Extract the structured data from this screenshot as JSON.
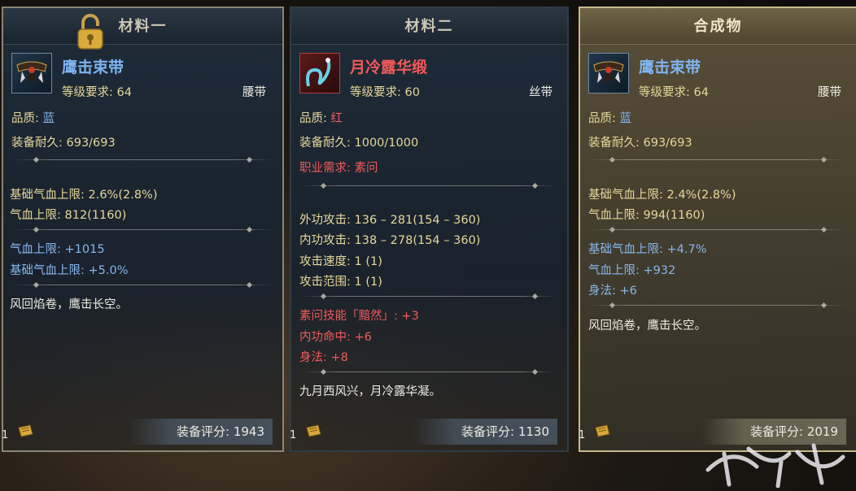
{
  "panels": [
    {
      "header": "材料一",
      "item_name": "鹰击束带",
      "level_req": "等级要求: 64",
      "slot": "腰带",
      "quality_label": "品质: ",
      "quality_value": "蓝",
      "durability": "装备耐久: 693/693",
      "base_stats": [
        "基础气血上限: 2.6%(2.8%)",
        "气血上限: 812(1160)"
      ],
      "bonus_stats": [
        "气血上限: +1015",
        "基础气血上限: +5.0%"
      ],
      "flavor": "风回焰卷，鹰击长空。",
      "quantity": "1",
      "score": "装备评分: 1943"
    },
    {
      "header": "材料二",
      "item_name": "月冷露华缎",
      "level_req": "等级要求: 60",
      "slot": "丝带",
      "quality_label": "品质: ",
      "quality_value": "红",
      "durability": "装备耐久: 1000/1000",
      "class_req": "职业需求: 素问",
      "base_stats": [
        "外功攻击: 136 – 281(154 – 360)",
        "内功攻击: 138 – 278(154 – 360)",
        "攻击速度: 1 (1)",
        "攻击范围: 1 (1)"
      ],
      "bonus_stats": [
        "素问技能「黯然」: +3",
        "内功命中: +6",
        "身法: +8"
      ],
      "flavor": "九月西风兴，月冷露华凝。",
      "quantity": "1",
      "score": "装备评分: 1130"
    },
    {
      "header": "合成物",
      "item_name": "鹰击束带",
      "level_req": "等级要求: 64",
      "slot": "腰带",
      "quality_label": "品质: ",
      "quality_value": "蓝",
      "durability": "装备耐久: 693/693",
      "base_stats": [
        "基础气血上限: 2.4%(2.8%)",
        "气血上限: 994(1160)"
      ],
      "bonus_stats": [
        "基础气血上限: +4.7%",
        "气血上限: +932",
        "身法: +6"
      ],
      "flavor": "风回焰卷，鹰击长空。",
      "quantity": "1",
      "score": "装备评分: 2019"
    }
  ],
  "colors": {
    "blue_text": "#86b6ec",
    "red_text": "#f05a5a",
    "label_gold": "#e6d79a"
  },
  "icons": {
    "lock": "padlock-icon",
    "scroll": "scroll-icon",
    "belt": "belt-item-icon",
    "ribbon": "ribbon-item-icon"
  }
}
